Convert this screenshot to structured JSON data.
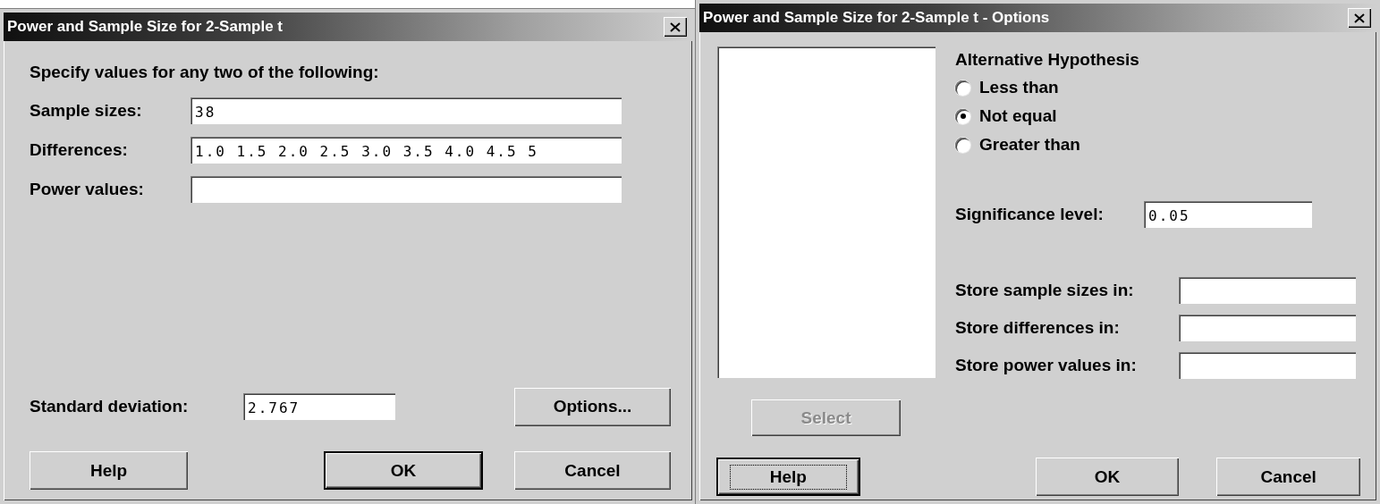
{
  "main_dialog": {
    "title": "Power and Sample Size for 2-Sample t",
    "instruction": "Specify values for any two of the following:",
    "fields": [
      {
        "label": "Sample sizes:",
        "value": "38"
      },
      {
        "label": "Differences:",
        "value": "1.0 1.5 2.0 2.5 3.0 3.5 4.0 4.5 5"
      },
      {
        "label": "Power values:"
      }
    ],
    "std_dev": {
      "label": "Standard deviation:",
      "value": "2.767"
    },
    "options_button": {
      "label": "Options..."
    },
    "buttons": [
      {
        "label": "Help",
        "default": false
      },
      {
        "label": "OK",
        "default": true
      },
      {
        "label": "Cancel",
        "default": false
      }
    ]
  },
  "options_dialog": {
    "title": "Power and Sample Size for 2-Sample t - Options",
    "select_button": {
      "label": "Select",
      "disabled": true
    },
    "group_label": "Alternative Hypothesis",
    "radios": [
      {
        "label": "Less than",
        "selected": false
      },
      {
        "label": "Not equal",
        "selected": true
      },
      {
        "label": "Greater than",
        "selected": false
      }
    ],
    "significance": {
      "label": "Significance level:",
      "value": "0.05"
    },
    "store_fields": [
      {
        "label": "Store sample sizes in:"
      },
      {
        "label": "Store differences in:"
      },
      {
        "label": "Store power values in:"
      }
    ],
    "buttons": [
      {
        "label": "Help",
        "default": true,
        "focused": true
      },
      {
        "label": "OK",
        "default": false,
        "focused": false
      },
      {
        "label": "Cancel",
        "default": false,
        "focused": false
      }
    ]
  }
}
